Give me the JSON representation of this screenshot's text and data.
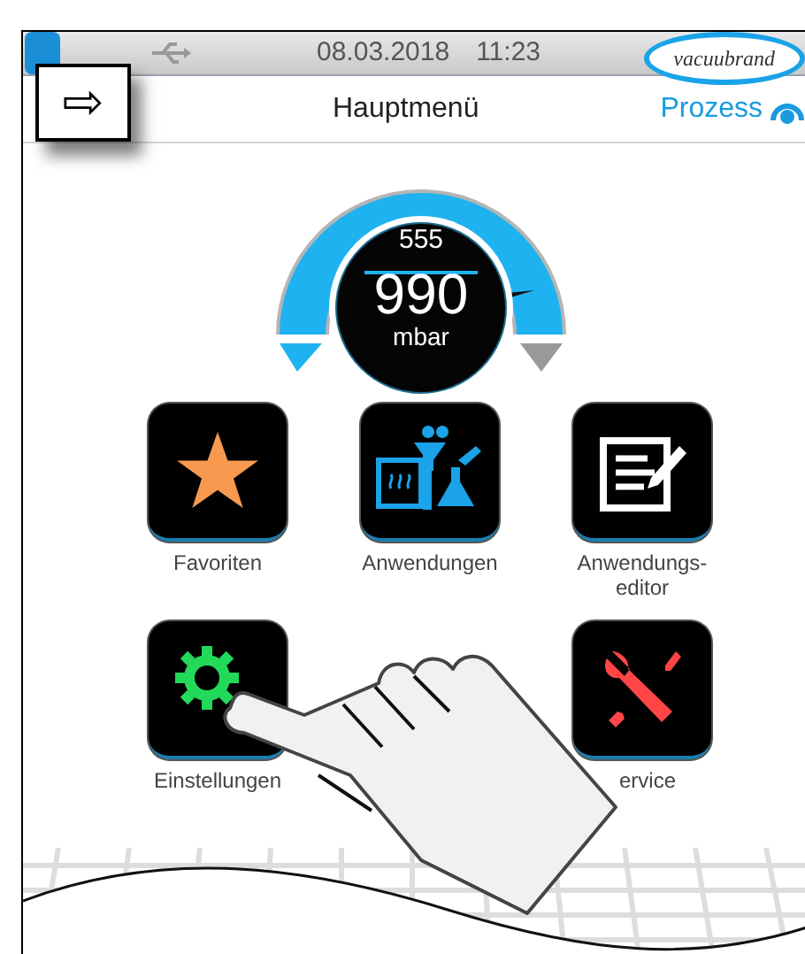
{
  "status_bar": {
    "date": "08.03.2018",
    "time": "11:23",
    "logo": "vacuubrand"
  },
  "popup": {
    "symbol": "⇨"
  },
  "header": {
    "title": "Hauptmenü",
    "process": "Prozess"
  },
  "gauge": {
    "setpoint": "555",
    "value": "990",
    "unit": "mbar"
  },
  "menu": [
    {
      "kind": "star",
      "label": "Favoriten"
    },
    {
      "kind": "lab",
      "label": "Anwendungen"
    },
    {
      "kind": "editor",
      "label": "Anwendungs-\neditor"
    },
    {
      "kind": "gear",
      "label": "Einstellungen"
    },
    {
      "kind": "hidden"
    },
    {
      "kind": "tools",
      "label": "ervice"
    }
  ]
}
